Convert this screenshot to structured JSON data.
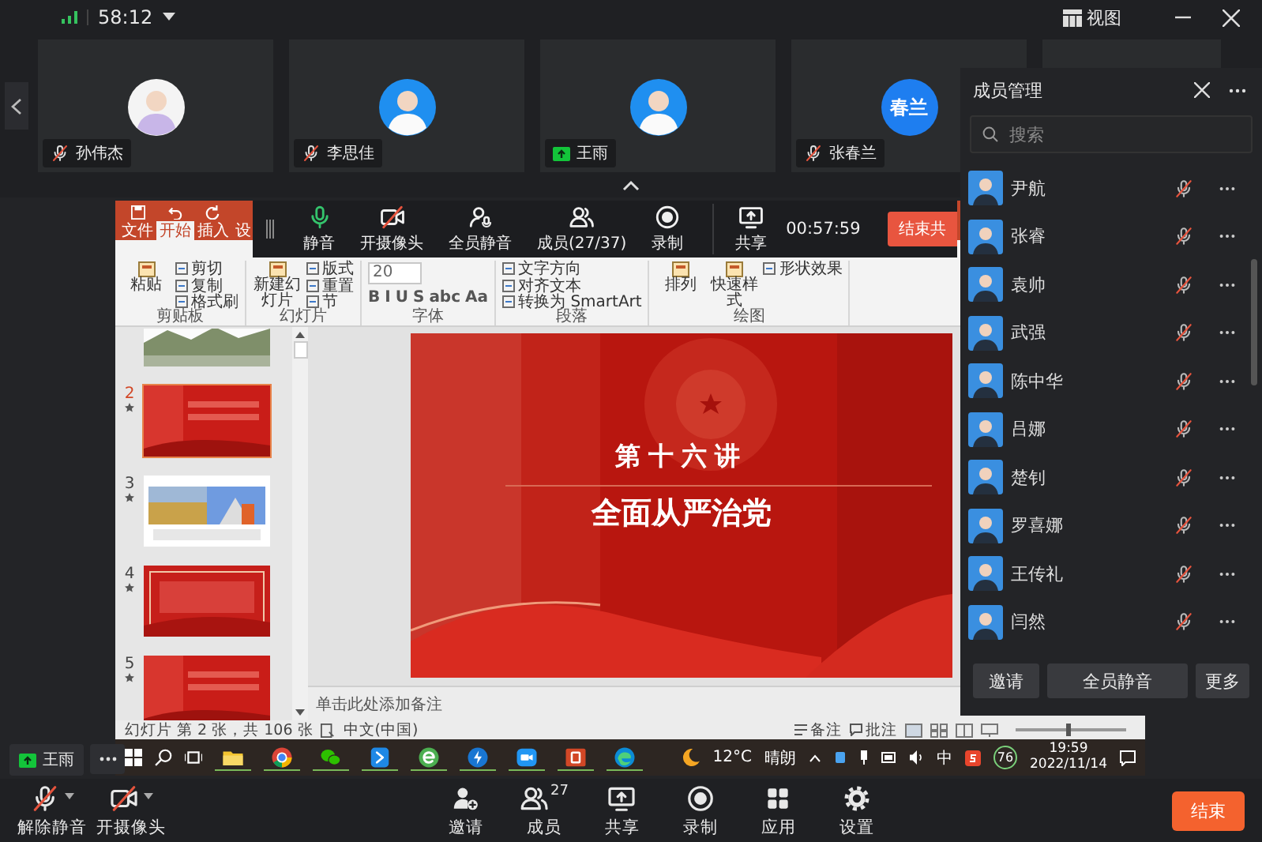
{
  "top_bar": {
    "time": "58:12",
    "view_button": "视图"
  },
  "video_tiles": [
    {
      "kind": "member",
      "name": "孙伟杰",
      "muted": true,
      "sharing": false
    },
    {
      "kind": "member",
      "name": "李思佳",
      "muted": true,
      "sharing": false
    },
    {
      "kind": "member",
      "name": "王雨",
      "sharing": true
    },
    {
      "kind": "member",
      "name": "张春兰",
      "muted": true,
      "sharing": false,
      "avatar": {
        "kind": "initials",
        "text": "春兰"
      }
    },
    {
      "kind": "empty"
    }
  ],
  "shared_screen": {
    "presenter": "王雨",
    "toolbar": {
      "buttons": [
        {
          "label": "静音"
        },
        {
          "label": "开摄像头"
        },
        {
          "label": "全员静音"
        },
        {
          "label": "成员(27/37)"
        },
        {
          "label": "录制"
        },
        {
          "label": "共享"
        }
      ],
      "timer": "00:57:59",
      "end_button": "结束共"
    },
    "powerpoint": {
      "tabs": [
        {
          "label": "文件",
          "selected": false
        },
        {
          "label": "开始",
          "selected": true
        },
        {
          "label": "插入",
          "selected": false
        },
        {
          "label": "设",
          "selected": false
        }
      ],
      "ribbon": [
        {
          "label": "剪贴板",
          "items": [
            {
              "label": "粘贴",
              "kind": "large"
            },
            {
              "label": "剪切",
              "kind": "small"
            },
            {
              "label": "复制",
              "kind": "small"
            },
            {
              "label": "格式刷",
              "kind": "small"
            }
          ]
        },
        {
          "label": "幻灯片",
          "items": [
            {
              "label": "新建幻灯片",
              "kind": "large"
            },
            {
              "label": "版式",
              "kind": "small"
            },
            {
              "label": "重置",
              "kind": "small"
            },
            {
              "label": "节",
              "kind": "small"
            }
          ]
        },
        {
          "label": "字体",
          "items": [
            {
              "label": "20",
              "kind": "field"
            },
            {
              "label": "B",
              "kind": "format"
            },
            {
              "label": "I",
              "kind": "format"
            },
            {
              "label": "U",
              "kind": "format"
            },
            {
              "label": "S",
              "kind": "format"
            },
            {
              "label": "abc",
              "kind": "format"
            },
            {
              "label": "Aa",
              "kind": "format"
            }
          ]
        },
        {
          "label": "段落",
          "items": [
            {
              "label": "文字方向",
              "kind": "small"
            },
            {
              "label": "对齐文本",
              "kind": "small"
            },
            {
              "label": "转换为 SmartArt",
              "kind": "small"
            }
          ]
        },
        {
          "label": "绘图",
          "items": [
            {
              "label": "排列",
              "kind": "large"
            },
            {
              "label": "快速样式",
              "kind": "large"
            },
            {
              "label": "形状效果",
              "kind": "small"
            }
          ]
        }
      ],
      "slides": [
        {
          "selected": false
        },
        {
          "number": "2",
          "starred": true,
          "selected": true
        },
        {
          "number": "3",
          "starred": true,
          "selected": false
        },
        {
          "number": "4",
          "starred": true,
          "selected": false
        },
        {
          "number": "5",
          "starred": true,
          "selected": false
        }
      ],
      "current_slide": {
        "kind": "picture",
        "title": "第十六讲",
        "subtitle": "全面从严治党"
      },
      "notes_placeholder": "单击此处添加备注",
      "status_bar": {
        "slide_info": "幻灯片 第 2 张，共 106 张",
        "language": "中文(中国)",
        "notes": "备注",
        "comments": "批注",
        "zoom": {
          "level": 0.45
        }
      }
    },
    "taskbar": {
      "apps": [
        {
          "kind": "folder"
        },
        {
          "kind": "chrome"
        },
        {
          "kind": "chat"
        },
        {
          "kind": "blue"
        },
        {
          "kind": "ie"
        },
        {
          "kind": "arrow"
        },
        {
          "kind": "meeting"
        },
        {
          "kind": "powerpoint"
        },
        {
          "kind": "edge"
        }
      ],
      "weather": {
        "temperature": "12°C",
        "condition": "晴朗"
      },
      "input_method": "中",
      "badge": "76",
      "time": "19:59",
      "date": "2022/11/14"
    }
  },
  "member_panel": {
    "title": "成员管理",
    "search": {
      "placeholder": "搜索"
    },
    "members": [
      {
        "name": "尹航",
        "muted": true
      },
      {
        "name": "张睿",
        "muted": true
      },
      {
        "name": "袁帅",
        "muted": true
      },
      {
        "name": "武强",
        "muted": true
      },
      {
        "name": "陈中华",
        "muted": true
      },
      {
        "name": "吕娜",
        "muted": true
      },
      {
        "name": "楚钊",
        "muted": true
      },
      {
        "name": "罗喜娜",
        "muted": true
      },
      {
        "name": "王传礼",
        "muted": true
      },
      {
        "name": "闫然",
        "muted": true
      }
    ],
    "buttons": [
      "邀请",
      "全员静音",
      "更多"
    ]
  },
  "bottom_toolbar": {
    "left": [
      {
        "label": "解除静音"
      },
      {
        "label": "开摄像头"
      }
    ],
    "center": [
      {
        "label": "邀请"
      },
      {
        "label": "成员",
        "badge": "27"
      },
      {
        "label": "共享"
      },
      {
        "label": "录制"
      },
      {
        "label": "应用"
      },
      {
        "label": "设置"
      }
    ],
    "end_button": "结束"
  }
}
